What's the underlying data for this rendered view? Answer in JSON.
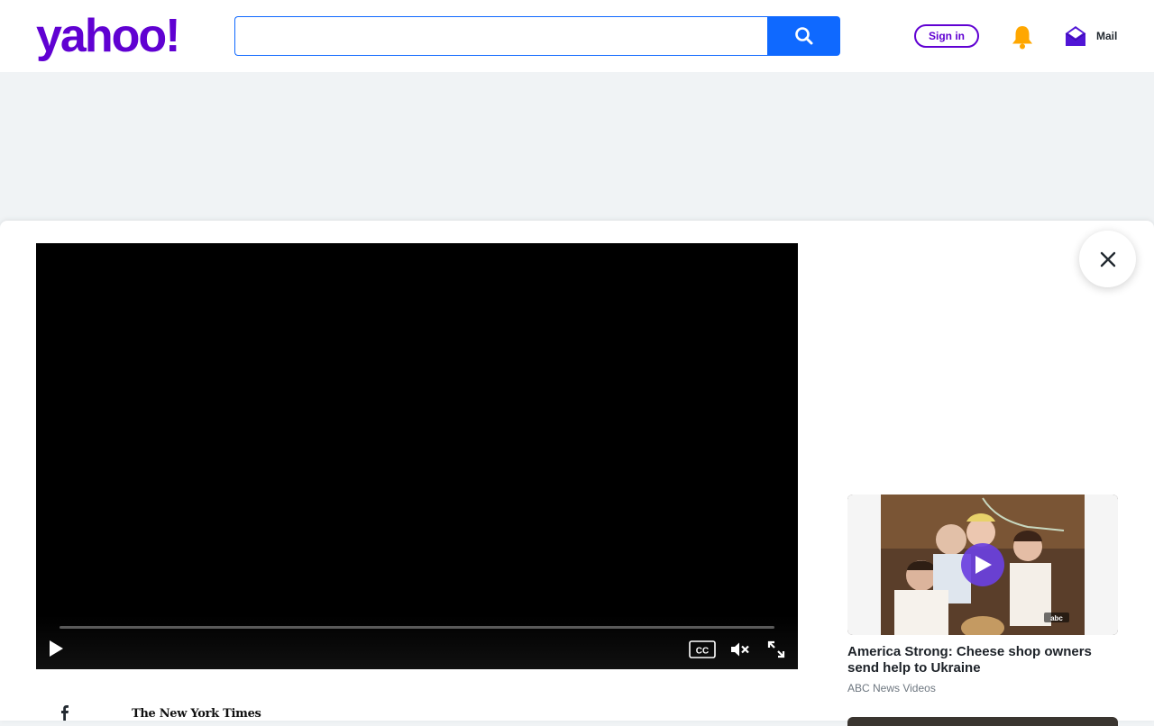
{
  "header": {
    "logo_text": "yahoo!",
    "search": {
      "value": "",
      "placeholder": ""
    },
    "signin_label": "Sign in",
    "mail_label": "Mail"
  },
  "video": {
    "state": "paused",
    "progress": 0.0,
    "muted": true,
    "captions_label": "CC"
  },
  "recommended": [
    {
      "title": "America Strong: Cheese shop owners send help to Ukraine",
      "source": "ABC News Videos",
      "badge": "abc"
    }
  ],
  "article": {
    "share_icon": "facebook-icon",
    "publisher": "The New York Times"
  },
  "colors": {
    "brand": "#6001d2",
    "search_accent": "#0f69ff",
    "bell": "#ffa700",
    "mail_icon": "#5015d6"
  }
}
